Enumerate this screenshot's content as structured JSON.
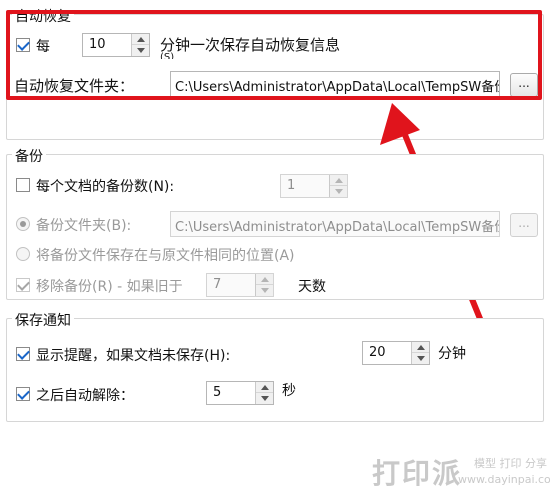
{
  "auto_recover": {
    "title": "自动恢复",
    "every_label": "每",
    "interval_value": "10",
    "interval_desc": "分钟一次保存自动恢复信息",
    "interval_desc_overflow": "(S)",
    "folder_label": "自动恢复文件夹：",
    "folder_path": "C:\\Users\\Administrator\\AppData\\Local\\TempSW备份",
    "browse_label": "..."
  },
  "backup": {
    "title": "备份",
    "count_label": "每个文档的备份数(N):",
    "count_value": "1",
    "folder_option_label": "备份文件夹(B):",
    "folder_path": "C:\\Users\\Administrator\\AppData\\Local\\TempSW备份",
    "browse_label": "...",
    "same_location_label": "将备份文件保存在与原文件相同的位置(A)",
    "remove_label": "移除备份(R) - 如果旧于",
    "remove_days_value": "7",
    "days_unit": "天数"
  },
  "save_notify": {
    "title": "保存通知",
    "reminder_label": "显示提醒，如果文档未保存(H):",
    "reminder_value": "20",
    "reminder_unit": "分钟",
    "auto_dismiss_label": "之后自动解除：",
    "auto_dismiss_value": "5",
    "auto_dismiss_unit": "秒"
  },
  "watermark": {
    "brand": "打印派",
    "tagline": "模型 打印 分享",
    "url": "www.dayinpai.com"
  },
  "colors": {
    "highlight_red": "#e0141c",
    "check_blue": "#1a66c9"
  }
}
